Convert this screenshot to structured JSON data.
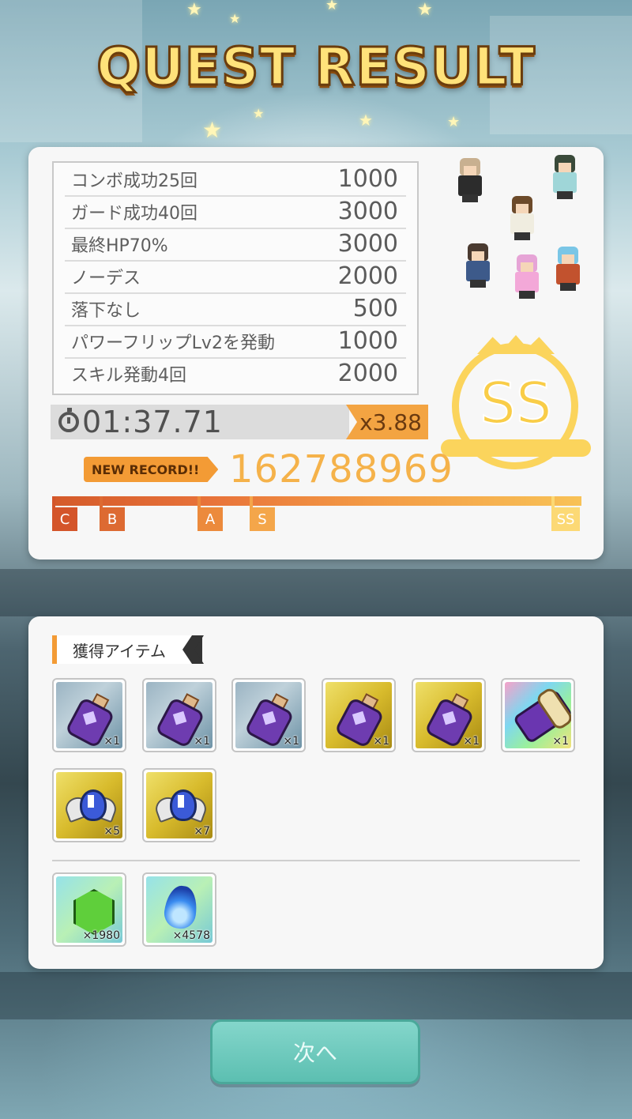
{
  "title": "QUEST RESULT",
  "bonuses": [
    {
      "label": "コンボ成功25回",
      "value": "1000"
    },
    {
      "label": "ガード成功40回",
      "value": "3000"
    },
    {
      "label": "最終HP70%",
      "value": "3000"
    },
    {
      "label": "ノーデス",
      "value": "2000"
    },
    {
      "label": "落下なし",
      "value": "500"
    },
    {
      "label": "パワーフリップLv2を発動",
      "value": "1000"
    },
    {
      "label": "スキル発動4回",
      "value": "2000"
    }
  ],
  "clear_time": "01:37.71",
  "multiplier": "x3.88",
  "new_record_label": "NEW RECORD!!",
  "total_score": "162788969",
  "rank": "SS",
  "rank_progress": 1.0,
  "rank_marks": [
    "C",
    "B",
    "A",
    "S",
    "SS"
  ],
  "acquired_items_label": "獲得アイテム",
  "items": [
    {
      "icon": "purple-potion-icon",
      "bg": "blue",
      "qty": "×1"
    },
    {
      "icon": "purple-potion-icon",
      "bg": "blue",
      "qty": "×1"
    },
    {
      "icon": "purple-potion-icon",
      "bg": "blue",
      "qty": "×1"
    },
    {
      "icon": "purple-potion-icon",
      "bg": "gold",
      "qty": "×1"
    },
    {
      "icon": "purple-potion-icon",
      "bg": "gold",
      "qty": "×1"
    },
    {
      "icon": "purple-scroll-icon",
      "bg": "rainbow",
      "qty": "×1"
    },
    {
      "icon": "winged-medal-icon",
      "bg": "gold",
      "qty": "×5"
    },
    {
      "icon": "winged-medal-icon",
      "bg": "gold",
      "qty": "×7"
    }
  ],
  "currencies": [
    {
      "icon": "green-gem-icon",
      "qty": "×1980"
    },
    {
      "icon": "blue-flame-icon",
      "qty": "×4578"
    }
  ],
  "next_button_label": "次へ",
  "colors": {
    "accent_orange": "#f39b35",
    "gold": "#fbd45c",
    "button_teal": "#5cbfb1"
  }
}
